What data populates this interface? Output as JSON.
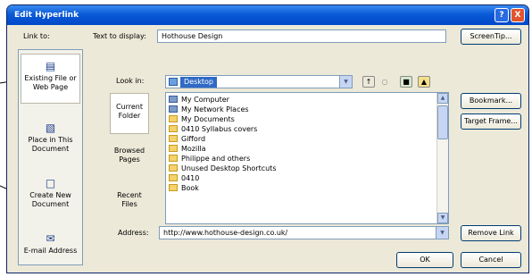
{
  "dialog": {
    "title": "Edit Hyperlink",
    "help_label": "?",
    "close_label": "X"
  },
  "link_to": {
    "label": "Link to:",
    "items": [
      {
        "label": "Existing File or Web Page",
        "icon": "web-page-icon",
        "selected": true
      },
      {
        "label": "Place in This Document",
        "icon": "document-place-icon",
        "selected": false
      },
      {
        "label": "Create New Document",
        "icon": "new-document-icon",
        "selected": false
      },
      {
        "label": "E-mail Address",
        "icon": "email-icon",
        "selected": false
      }
    ]
  },
  "text_to_display": {
    "label": "Text to display:",
    "value": "Hothouse Design",
    "screentip_label": "ScreenTip..."
  },
  "look_in": {
    "label": "Look in:",
    "value": "Desktop",
    "icons": [
      "up-folder-icon",
      "search-web-icon",
      "folder-icon",
      "open-folder-icon"
    ]
  },
  "sidebar": {
    "items": [
      {
        "label": "Current Folder",
        "selected": true
      },
      {
        "label": "Browsed Pages",
        "selected": false
      },
      {
        "label": "Recent Files",
        "selected": false
      }
    ]
  },
  "files": [
    {
      "name": "My Computer",
      "icon": "computer-icon"
    },
    {
      "name": "My Network Places",
      "icon": "network-icon"
    },
    {
      "name": "My Documents",
      "icon": "folder-icon"
    },
    {
      "name": "0410 Syllabus covers",
      "icon": "folder-icon"
    },
    {
      "name": "Gifford",
      "icon": "folder-icon"
    },
    {
      "name": "Mozilla",
      "icon": "folder-icon"
    },
    {
      "name": "Philippe and others",
      "icon": "folder-icon"
    },
    {
      "name": "Unused Desktop Shortcuts",
      "icon": "folder-icon"
    },
    {
      "name": "0410",
      "icon": "folder-icon"
    },
    {
      "name": "Book",
      "icon": "folder-icon"
    }
  ],
  "right_buttons": {
    "bookmark": "Bookmark...",
    "target_frame": "Target Frame...",
    "remove_link": "Remove Link"
  },
  "address": {
    "label": "Address:",
    "value": "http://www.hothouse-design.co.uk/"
  },
  "footer": {
    "ok": "OK",
    "cancel": "Cancel"
  },
  "colors": {
    "title_bar": "#0a5ad8",
    "dialog_bg": "#ece9d8",
    "selection": "#316ac5"
  }
}
